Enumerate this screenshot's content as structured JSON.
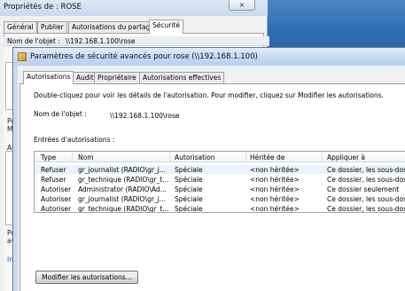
{
  "background_window": {
    "title": "Propriétés de : ROSE",
    "close_glyph": "×",
    "tabs": [
      "Général",
      "Publier",
      "Autorisations du partage",
      "Sécurité"
    ],
    "object_label": "Nom de l'objet :",
    "object_path": "\\\\192.168.1.100\\rose",
    "left_fragments": [
      "Po",
      "Me",
      "Au",
      "Po",
      "ava"
    ],
    "link_fragment": "Inf"
  },
  "dialog": {
    "title": "Paramètres de sécurité avancés pour rose (\\\\192.168.1.100)",
    "tabs": [
      "Autorisations",
      "Audit",
      "Propriétaire",
      "Autorisations effectives"
    ],
    "description": "Double-cliquez pour voir les détails de l'autorisation. Pour modifier, cliquez sur Modifier les autorisations.",
    "object_label": "Nom de l'objet :",
    "object_path": "\\\\192.168.1.100\\rose",
    "entries_label": "Entrées d'autorisations :",
    "columns": [
      "Type",
      "Nom",
      "Autorisation",
      "Héritée de",
      "Appliquer à"
    ],
    "rows": [
      {
        "type": "Refuser",
        "name": "gr_journalist (RADIO\\gr_j...",
        "permission": "Spéciale",
        "inherited": "<non héritée>",
        "apply": "Ce dossier, les sous-dossiers"
      },
      {
        "type": "Refuser",
        "name": "gr_technique (RADIO\\gr_t...",
        "permission": "Spéciale",
        "inherited": "<non héritée>",
        "apply": "Ce dossier, les sous-dossiers"
      },
      {
        "type": "Autoriser",
        "name": "Administrator (RADIO\\Ad...",
        "permission": "Spéciale",
        "inherited": "<non héritée>",
        "apply": "Ce dossier seulement"
      },
      {
        "type": "Autoriser",
        "name": "gr_journalist (RADIO\\gr_j...",
        "permission": "Spéciale",
        "inherited": "<non héritée>",
        "apply": "Ce dossier, les sous-dossiers"
      },
      {
        "type": "Autoriser",
        "name": "gr_technique (RADIO\\gr_t...",
        "permission": "Spéciale",
        "inherited": "<non héritée>",
        "apply": "Ce dossier, les sous-dossiers"
      }
    ],
    "modify_button": "Modifier les autorisations..."
  },
  "colors": {
    "titlebar": "#c5d9f1",
    "selection": "#eaf2fb",
    "desktop": "#2e6db3"
  }
}
